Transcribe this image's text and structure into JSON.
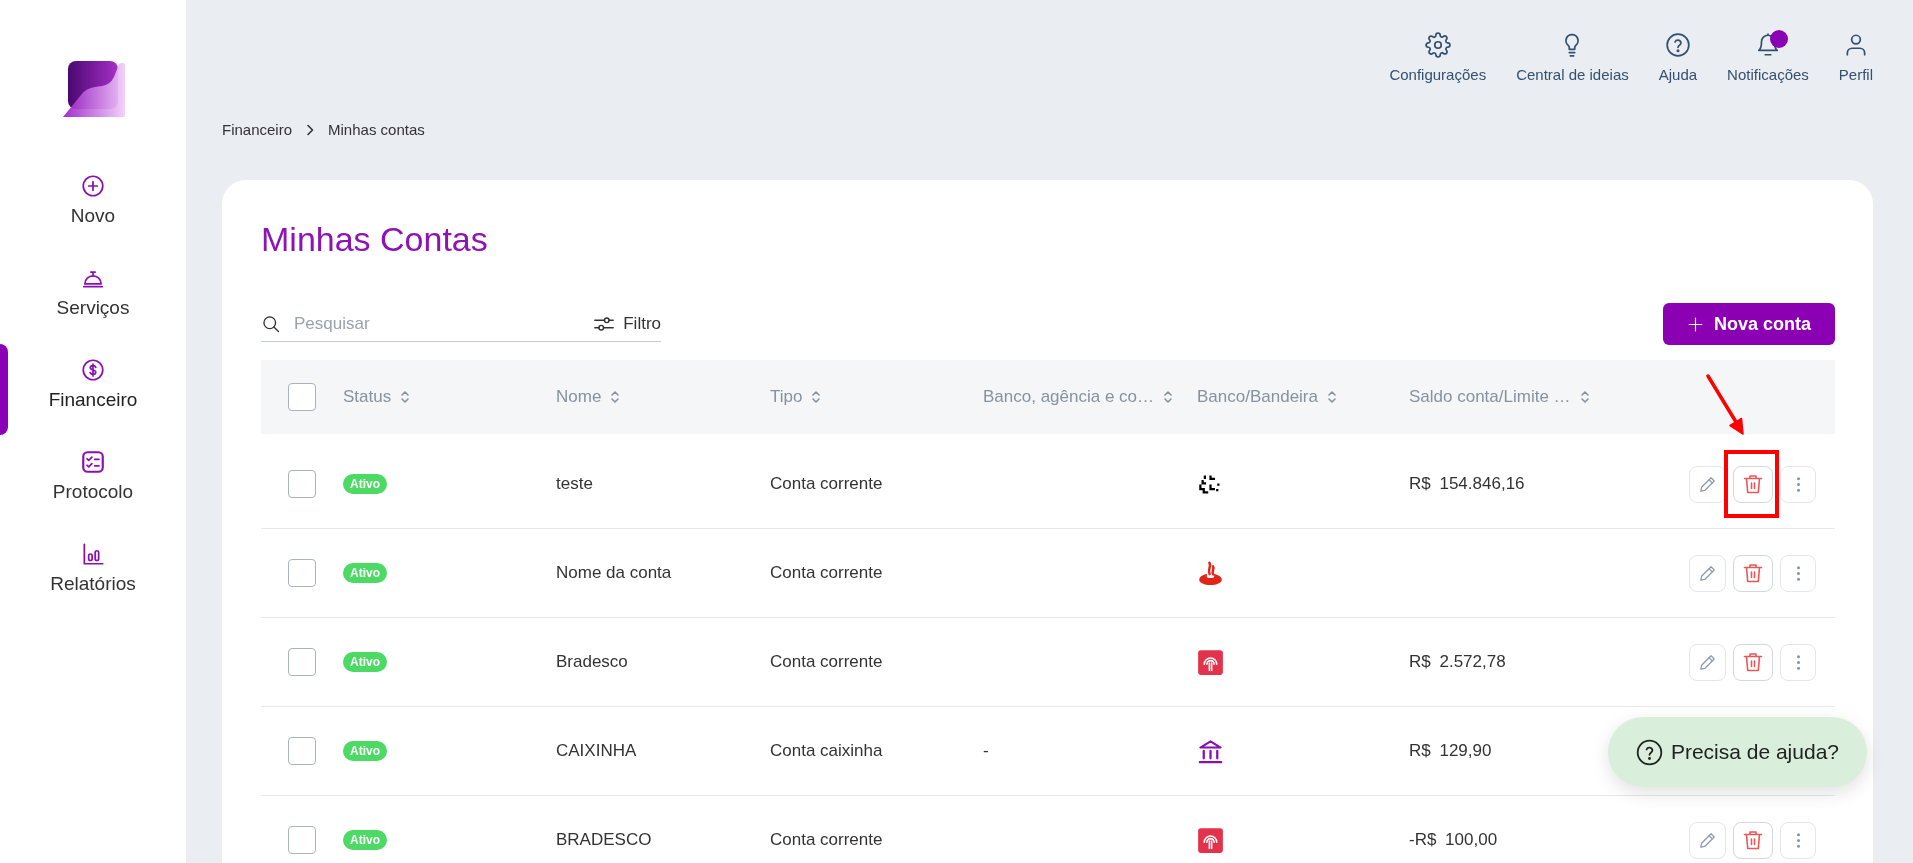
{
  "sidebar": {
    "items": [
      {
        "kind": "new",
        "label": "Novo",
        "selected": false
      },
      {
        "kind": "services",
        "label": "Serviços",
        "selected": false
      },
      {
        "kind": "finance",
        "label": "Financeiro",
        "selected": true
      },
      {
        "kind": "protocol",
        "label": "Protocolo",
        "selected": false
      },
      {
        "kind": "reports",
        "label": "Relatórios",
        "selected": false
      }
    ]
  },
  "topbar": {
    "items": [
      {
        "kind": "settings",
        "label": "Configurações",
        "unread": false
      },
      {
        "kind": "ideas",
        "label": "Central de ideias",
        "unread": false
      },
      {
        "kind": "help",
        "label": "Ajuda",
        "unread": false
      },
      {
        "kind": "notifications",
        "label": "Notificações",
        "unread": true
      },
      {
        "kind": "profile",
        "label": "Perfil",
        "unread": false
      }
    ]
  },
  "breadcrumb": [
    "Financeiro",
    "Minhas contas"
  ],
  "page": {
    "title": "Minhas Contas"
  },
  "toolbar": {
    "search": {
      "placeholder": "Pesquisar"
    },
    "filter_button": "Filtro",
    "new_button": "Nova conta"
  },
  "table": {
    "select_all": {
      "checked": false
    },
    "columns": [
      "Status",
      "Nome",
      "Tipo",
      "Banco, agência e co…",
      "Banco/Bandeira",
      "Saldo conta/Limite …"
    ],
    "rows": [
      {
        "checked": false,
        "status": "Ativo",
        "name": "teste",
        "type": "Conta corrente",
        "bank_logo": {
          "kind": "abstract"
        },
        "balance": "R$ 154.846,16",
        "actions_visible": true,
        "highlighted": true
      },
      {
        "checked": false,
        "status": "Ativo",
        "name": "Nome da conta",
        "type": "Conta corrente",
        "bank_logo": {
          "kind": "flame"
        },
        "actions_visible": true,
        "highlighted": false
      },
      {
        "checked": false,
        "status": "Ativo",
        "name": "Bradesco",
        "type": "Conta corrente",
        "bank_logo": {
          "kind": "arch"
        },
        "balance": "R$ 2.572,78",
        "actions_visible": true,
        "highlighted": false
      },
      {
        "checked": false,
        "status": "Ativo",
        "name": "CAIXINHA",
        "type": "Conta caixinha",
        "bank_details": "-",
        "bank_logo": {
          "kind": "building"
        },
        "balance": "R$ 129,90",
        "actions_visible": false,
        "highlighted": false
      },
      {
        "checked": false,
        "status": "Ativo",
        "name": "BRADESCO",
        "type": "Conta corrente",
        "bank_logo": {
          "kind": "arch"
        },
        "balance": "-R$ 100,00",
        "actions_visible": true,
        "highlighted": false
      }
    ]
  },
  "help_button": "Precisa de ajuda?"
}
